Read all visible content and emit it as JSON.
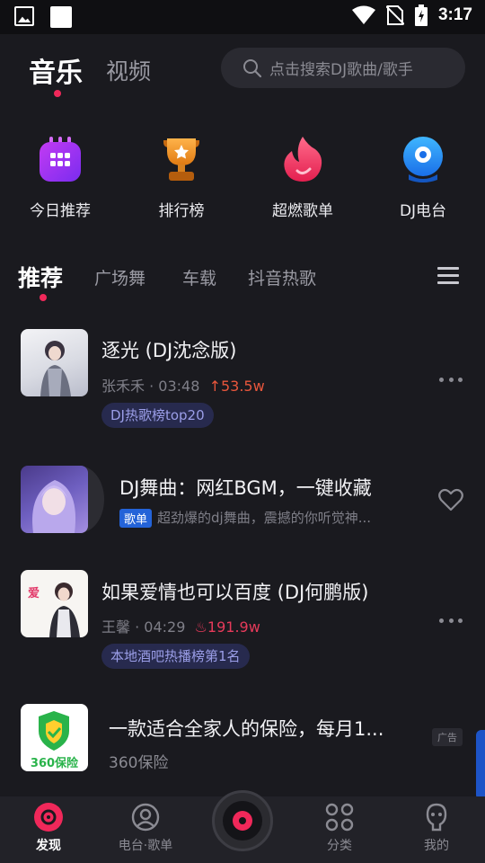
{
  "status_bar": {
    "time": "3:17"
  },
  "top_tabs": {
    "active": "音乐",
    "other": "视频"
  },
  "search": {
    "placeholder": "点击搜索DJ歌曲/歌手"
  },
  "quick_entries": [
    {
      "label": "今日推荐",
      "icon": "calendar-icon"
    },
    {
      "label": "排行榜",
      "icon": "trophy-icon"
    },
    {
      "label": "超燃歌单",
      "icon": "flame-icon"
    },
    {
      "label": "DJ电台",
      "icon": "radio-icon"
    }
  ],
  "category_tabs": {
    "active": "推荐",
    "items": [
      "广场舞",
      "车载",
      "抖音热歌"
    ]
  },
  "songs": [
    {
      "title": "逐光 (DJ沈念版)",
      "artist": "张禾禾",
      "duration": "03:48",
      "plays": "53.5w",
      "tag": "DJ热歌榜top20"
    },
    {
      "title": "如果爱情也可以百度 (DJ何鹏版)",
      "artist": "王馨",
      "duration": "04:29",
      "plays": "191.9w",
      "tag": "本地酒吧热播榜第1名"
    }
  ],
  "playlist_card": {
    "title": "DJ舞曲：网红BGM，一键收藏",
    "badge": "歌单",
    "desc": "超劲爆的dj舞曲，震撼的你听觉神..."
  },
  "ad_card": {
    "title": "一款适合全家人的保险，每月1...",
    "brand": "360保险",
    "badge": "广告",
    "logo_text": "360保险"
  },
  "bottom_nav": [
    {
      "label": "发现",
      "icon": "disc-icon",
      "active": true
    },
    {
      "label": "电台·歌单",
      "icon": "user-radio-icon",
      "active": false
    },
    {
      "label": "分类",
      "icon": "grid-icon",
      "active": false
    },
    {
      "label": "我的",
      "icon": "profile-icon",
      "active": false
    }
  ],
  "colors": {
    "accent": "#f0285a",
    "background": "#1a1a1f",
    "tag_bg": "#272a4e",
    "tag_text": "#9b9ee8"
  }
}
